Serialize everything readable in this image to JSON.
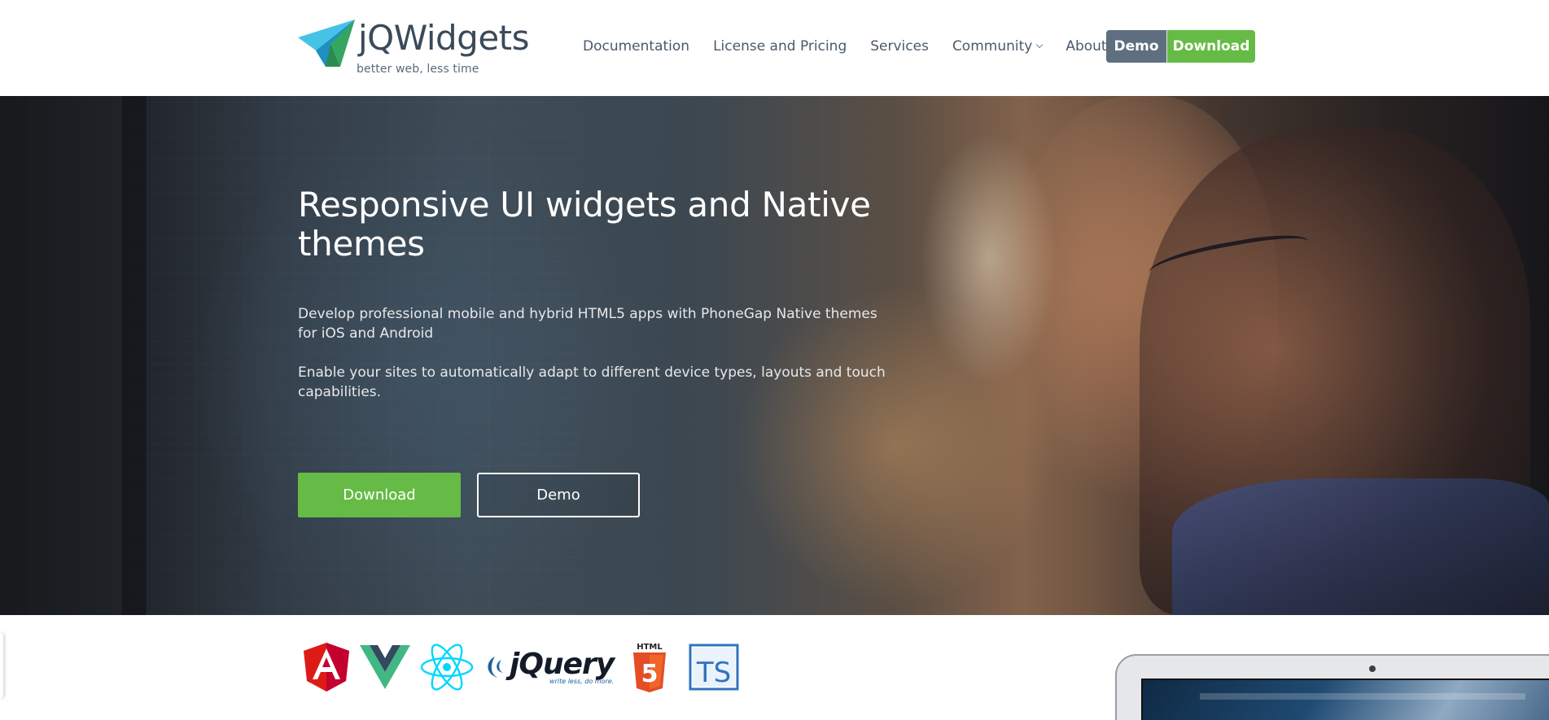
{
  "header": {
    "brand_name": "jQWidgets",
    "brand_tagline": "better web, less time",
    "nav": [
      {
        "label": "Documentation",
        "dropdown": false
      },
      {
        "label": "License and Pricing",
        "dropdown": false
      },
      {
        "label": "Services",
        "dropdown": false
      },
      {
        "label": "Community",
        "dropdown": true
      },
      {
        "label": "About",
        "dropdown": true
      }
    ],
    "demo_label": "Demo",
    "download_label": "Download"
  },
  "hero": {
    "title": "Responsive UI widgets and Native themes",
    "paragraph_1": "Develop professional mobile and hybrid HTML5 apps with PhoneGap Native themes for iOS and Android",
    "paragraph_2": "Enable your sites to automatically adapt to different device types, layouts and touch capabilities.",
    "download_label": "Download",
    "demo_label": "Demo"
  },
  "tech_logos": {
    "angular": "angular-icon",
    "vue": "vue-icon",
    "react": "react-icon",
    "jquery_word": "jQuery",
    "jquery_tagline": "write less, do more.",
    "html5_label": "HTML",
    "html5_digit": "5",
    "typescript_label": "TS"
  },
  "colors": {
    "brand_green": "#66bb46",
    "header_demo_gray": "#5f6f7f",
    "nav_text": "#4a5a6a",
    "logo_blue": "#35b4e0",
    "logo_green": "#2d9b6c"
  }
}
